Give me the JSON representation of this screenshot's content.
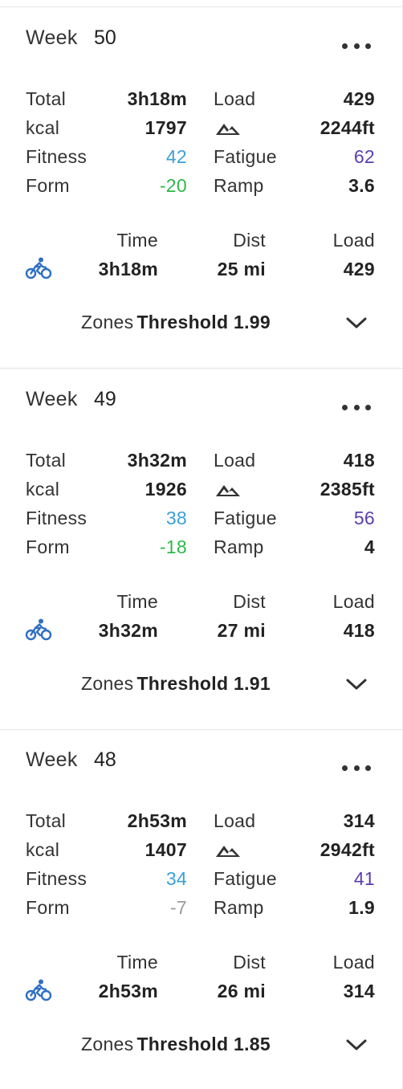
{
  "colors": {
    "fitness": "#3aa0d8",
    "fatigue": "#5b3db0",
    "form_positive": "#2eb84a",
    "form_neutral": "#9a9a9a",
    "bike": "#2e6fc4"
  },
  "icons": {
    "more": "more-horizontal-icon",
    "elevation": "mountain-icon",
    "activity": "bike-icon",
    "expand": "chevron-down-icon"
  },
  "weeks": [
    {
      "label": "Week",
      "number": "50",
      "total_label": "Total",
      "total": "3h18m",
      "load_label": "Load",
      "load": "429",
      "kcal_label": "kcal",
      "kcal": "1797",
      "elevation": "2244ft",
      "fitness_label": "Fitness",
      "fitness": "42",
      "fatigue_label": "Fatigue",
      "fatigue": "62",
      "form_label": "Form",
      "form": "-20",
      "form_color": "#2eb84a",
      "ramp_label": "Ramp",
      "ramp": "3.6",
      "summary": {
        "time_label": "Time",
        "dist_label": "Dist",
        "load_label": "Load",
        "time": "3h18m",
        "dist": "25 mi",
        "load": "429"
      },
      "zones_label": "Zones",
      "zones_value": "Threshold 1.99"
    },
    {
      "label": "Week",
      "number": "49",
      "total_label": "Total",
      "total": "3h32m",
      "load_label": "Load",
      "load": "418",
      "kcal_label": "kcal",
      "kcal": "1926",
      "elevation": "2385ft",
      "fitness_label": "Fitness",
      "fitness": "38",
      "fatigue_label": "Fatigue",
      "fatigue": "56",
      "form_label": "Form",
      "form": "-18",
      "form_color": "#2eb84a",
      "ramp_label": "Ramp",
      "ramp": "4",
      "summary": {
        "time_label": "Time",
        "dist_label": "Dist",
        "load_label": "Load",
        "time": "3h32m",
        "dist": "27 mi",
        "load": "418"
      },
      "zones_label": "Zones",
      "zones_value": "Threshold 1.91"
    },
    {
      "label": "Week",
      "number": "48",
      "total_label": "Total",
      "total": "2h53m",
      "load_label": "Load",
      "load": "314",
      "kcal_label": "kcal",
      "kcal": "1407",
      "elevation": "2942ft",
      "fitness_label": "Fitness",
      "fitness": "34",
      "fatigue_label": "Fatigue",
      "fatigue": "41",
      "form_label": "Form",
      "form": "-7",
      "form_color": "#9a9a9a",
      "ramp_label": "Ramp",
      "ramp": "1.9",
      "summary": {
        "time_label": "Time",
        "dist_label": "Dist",
        "load_label": "Load",
        "time": "2h53m",
        "dist": "26 mi",
        "load": "314"
      },
      "zones_label": "Zones",
      "zones_value": "Threshold 1.85"
    }
  ]
}
